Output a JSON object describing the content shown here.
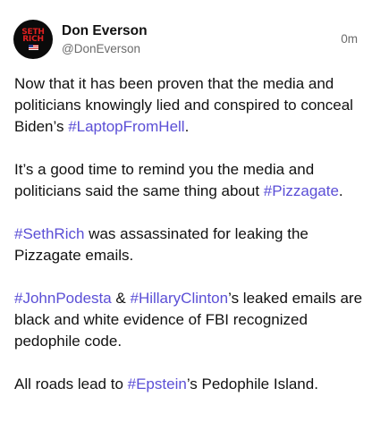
{
  "post": {
    "author": {
      "avatar_icon": "seth-rich-avatar",
      "avatar_text": {
        "line1": "SETH",
        "line2": "RICH"
      },
      "display_name": "Don Everson",
      "handle": "@DonEverson"
    },
    "timestamp": "0m",
    "accent_color": "#5b4fd6",
    "paragraphs": [
      {
        "segments": [
          {
            "text": "Now that it has been proven that the media and politicians knowingly lied and conspired to conceal Biden’s "
          },
          {
            "tag": "#LaptopFromHell"
          },
          {
            "text": "."
          }
        ]
      },
      {
        "segments": [
          {
            "text": "It’s a good time to remind you the media and politicians said the same thing about "
          },
          {
            "tag": "#Pizzagate"
          },
          {
            "text": "."
          }
        ]
      },
      {
        "segments": [
          {
            "tag": "#SethRich"
          },
          {
            "text": " was assassinated for leaking the Pizzagate emails."
          }
        ]
      },
      {
        "segments": [
          {
            "tag": "#JohnPodesta"
          },
          {
            "text": " & "
          },
          {
            "tag": "#HillaryClinton"
          },
          {
            "text": "’s leaked emails are black and white evidence of FBI recognized pedophile code."
          }
        ]
      },
      {
        "segments": [
          {
            "text": "All roads lead to "
          },
          {
            "tag": "#Epstein"
          },
          {
            "text": "’s Pedophile Island."
          }
        ]
      }
    ]
  }
}
